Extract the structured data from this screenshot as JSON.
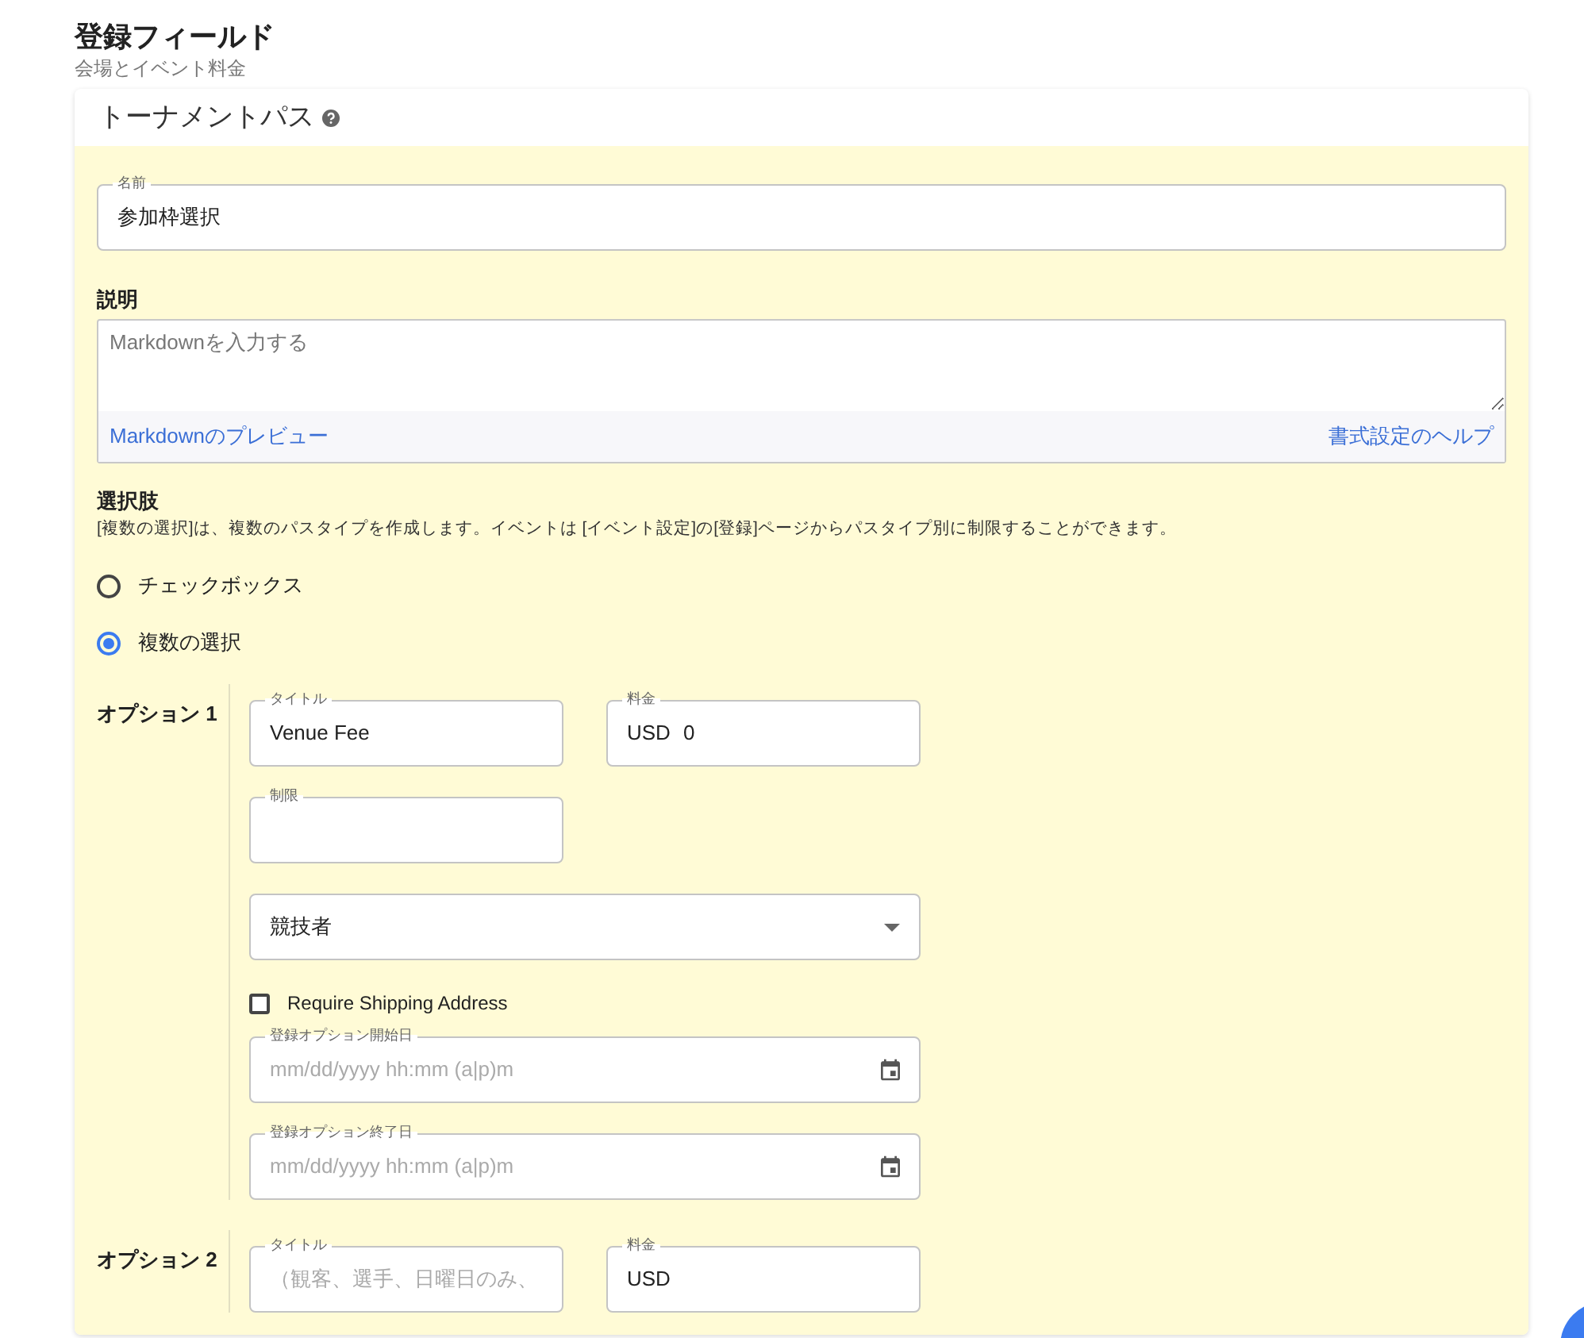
{
  "page": {
    "title": "登録フィールド",
    "subtitle": "会場とイベント料金"
  },
  "card": {
    "title": "トーナメントパス",
    "name_field": {
      "label": "名前",
      "value": "参加枠選択"
    },
    "description": {
      "label": "説明",
      "placeholder": "Markdownを入力する",
      "preview_link": "Markdownのプレビュー",
      "help_link": "書式設定のヘルプ"
    },
    "choices": {
      "label": "選択肢",
      "note": "[複数の選択]は、複数のパスタイプを作成します。イベントは [イベント設定]の[登録]ページからパスタイプ別に制限することができます。",
      "types": [
        {
          "label": "チェックボックス",
          "selected": false
        },
        {
          "label": "複数の選択",
          "selected": true
        }
      ]
    },
    "options": [
      {
        "label": "オプション 1",
        "title": {
          "label": "タイトル",
          "value": "Venue Fee"
        },
        "fee": {
          "label": "料金",
          "currency": "USD",
          "value": "0"
        },
        "limit": {
          "label": "制限"
        },
        "audience": {
          "value": "競技者"
        },
        "shipping": {
          "label": "Require Shipping Address",
          "checked": false
        },
        "start": {
          "label": "登録オプション開始日",
          "placeholder": "mm/dd/yyyy hh:mm (a|p)m"
        },
        "end": {
          "label": "登録オプション終了日",
          "placeholder": "mm/dd/yyyy hh:mm (a|p)m"
        }
      },
      {
        "label": "オプション 2",
        "title": {
          "label": "タイトル",
          "placeholder": "（観客、選手、日曜日のみ、"
        },
        "fee": {
          "label": "料金",
          "currency": "USD"
        }
      }
    ]
  }
}
